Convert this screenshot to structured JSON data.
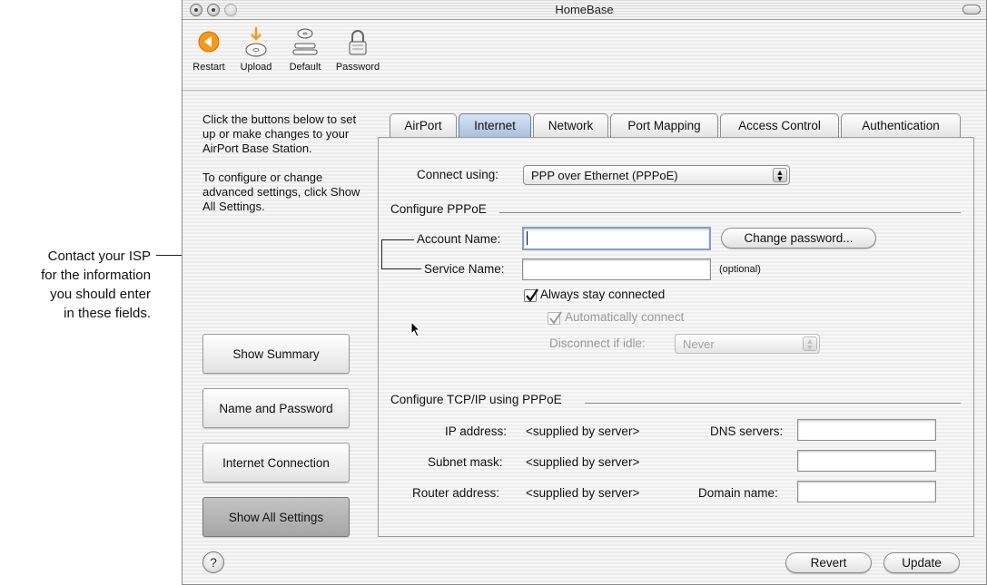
{
  "callout": {
    "lines": [
      "Contact your ISP",
      "for the information",
      "you should enter",
      "in these fields."
    ]
  },
  "window": {
    "title": "HomeBase"
  },
  "toolbar": {
    "items": [
      {
        "label": "Restart",
        "icon": "restart-icon"
      },
      {
        "label": "Upload",
        "icon": "upload-icon"
      },
      {
        "label": "Default",
        "icon": "default-icon"
      },
      {
        "label": "Password",
        "icon": "password-lock-icon"
      }
    ]
  },
  "sidebar": {
    "intro1": "Click the buttons below to set up or make changes to your AirPort Base Station.",
    "intro2": "To configure or change advanced settings, click Show All Settings.",
    "buttons": [
      "Show Summary",
      "Name and Password",
      "Internet Connection",
      "Show All Settings"
    ]
  },
  "tabs": [
    "AirPort",
    "Internet",
    "Network",
    "Port Mapping",
    "Access Control",
    "Authentication"
  ],
  "active_tab": "Internet",
  "internet": {
    "connect_using_label": "Connect using:",
    "connect_using_value": "PPP over Ethernet (PPPoE)",
    "pppoe_group": "Configure PPPoE",
    "account_name_label": "Account Name:",
    "account_name_value": "",
    "change_password_label": "Change password...",
    "service_name_label": "Service Name:",
    "service_name_value": "",
    "optional_label": "(optional)",
    "always_connected_label": "Always stay connected",
    "always_connected_checked": true,
    "auto_connect_label": "Automatically connect",
    "auto_connect_checked": true,
    "disconnect_idle_label": "Disconnect if idle:",
    "disconnect_idle_value": "Never",
    "tcpip_group": "Configure TCP/IP using PPPoE",
    "ip_address_label": "IP address:",
    "ip_address_value": "<supplied by server>",
    "subnet_mask_label": "Subnet mask:",
    "subnet_mask_value": "<supplied by server>",
    "router_address_label": "Router address:",
    "router_address_value": "<supplied by server>",
    "dns_servers_label": "DNS servers:",
    "domain_name_label": "Domain name:"
  },
  "footer": {
    "help_label": "?",
    "revert_label": "Revert",
    "update_label": "Update"
  }
}
